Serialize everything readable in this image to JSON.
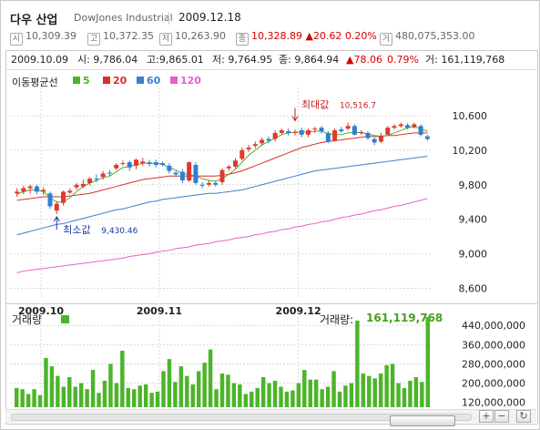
{
  "header": {
    "title": "다우 산업",
    "subtitle": "DowJones Industrial",
    "date": "2009.12.18",
    "quotes": [
      {
        "icon": "시",
        "value": "10,309.39"
      },
      {
        "icon": "고",
        "value": "10,372.35"
      },
      {
        "icon": "저",
        "value": "10,263.90"
      },
      {
        "icon": "종",
        "value": "10,328.89"
      },
      {
        "icon": "",
        "value": "▲20.62"
      },
      {
        "icon": "",
        "value": "0.20%"
      },
      {
        "icon": "거",
        "value": "480,075,353.00"
      }
    ]
  },
  "info_row": {
    "date": "2009.10.09",
    "open": "시: 9,786.04",
    "high": "고:9,865.01",
    "low": "저: 9,764.95",
    "close": "종: 9,864.94",
    "change": "▲78.06",
    "pct": "0.79%",
    "volume": "거: 161,119,768"
  },
  "legend": {
    "title": "이동평균선",
    "items": [
      {
        "label": "5",
        "color": "#4db42a"
      },
      {
        "label": "20",
        "color": "#d9302a"
      },
      {
        "label": "60",
        "color": "#3c7fd0"
      },
      {
        "label": "120",
        "color": "#e85fc8"
      }
    ]
  },
  "annotations": {
    "max_label": "최대값",
    "max_value": "10,516.7",
    "min_label": "최소값",
    "min_value": "9,430.46"
  },
  "volume": {
    "title": "거래량",
    "value_label": "거래량:",
    "value": "161,119,768",
    "ticks": [
      "440,000,000",
      "360,000,000",
      "280,000,000",
      "200,000,000",
      "120,000,000"
    ]
  },
  "chart_data": [
    {
      "type": "candlestick",
      "title": "다우 산업",
      "x_labels": [
        "2009.10",
        "2009.11",
        "2009.12"
      ],
      "y_ticks": [
        10600,
        10200,
        9800,
        9400,
        9000,
        8600
      ],
      "ylim": [
        8500,
        10800
      ],
      "candles": [
        {
          "o": 9700,
          "c": 9720,
          "h": 9760,
          "l": 9660
        },
        {
          "o": 9720,
          "c": 9760,
          "h": 9790,
          "l": 9690
        },
        {
          "o": 9760,
          "c": 9780,
          "h": 9800,
          "l": 9700
        },
        {
          "o": 9780,
          "c": 9720,
          "h": 9800,
          "l": 9690
        },
        {
          "o": 9720,
          "c": 9740,
          "h": 9770,
          "l": 9680
        },
        {
          "o": 9700,
          "c": 9550,
          "h": 9720,
          "l": 9520
        },
        {
          "o": 9500,
          "c": 9580,
          "h": 9610,
          "l": 9460
        },
        {
          "o": 9590,
          "c": 9720,
          "h": 9730,
          "l": 9560
        },
        {
          "o": 9710,
          "c": 9730,
          "h": 9760,
          "l": 9690
        },
        {
          "o": 9770,
          "c": 9800,
          "h": 9820,
          "l": 9740
        },
        {
          "o": 9780,
          "c": 9810,
          "h": 9860,
          "l": 9760
        },
        {
          "o": 9820,
          "c": 9870,
          "h": 9890,
          "l": 9790
        },
        {
          "o": 9870,
          "c": 9860,
          "h": 9920,
          "l": 9830
        },
        {
          "o": 9890,
          "c": 9930,
          "h": 9960,
          "l": 9860
        },
        {
          "o": 9940,
          "c": 9930,
          "h": 9970,
          "l": 9900
        },
        {
          "o": 9990,
          "c": 10030,
          "h": 10050,
          "l": 9970
        },
        {
          "o": 10040,
          "c": 10050,
          "h": 10080,
          "l": 10020
        },
        {
          "o": 10060,
          "c": 10000,
          "h": 10080,
          "l": 9960
        },
        {
          "o": 10020,
          "c": 10090,
          "h": 10100,
          "l": 9980
        },
        {
          "o": 10050,
          "c": 10070,
          "h": 10110,
          "l": 10020
        },
        {
          "o": 10060,
          "c": 10040,
          "h": 10090,
          "l": 10010
        },
        {
          "o": 10060,
          "c": 10030,
          "h": 10090,
          "l": 10000
        },
        {
          "o": 10050,
          "c": 10030,
          "h": 10070,
          "l": 10010
        },
        {
          "o": 10020,
          "c": 9960,
          "h": 10050,
          "l": 9930
        },
        {
          "o": 9940,
          "c": 9920,
          "h": 9960,
          "l": 9890
        },
        {
          "o": 9950,
          "c": 9850,
          "h": 9980,
          "l": 9820
        },
        {
          "o": 9850,
          "c": 10060,
          "h": 10070,
          "l": 9830
        },
        {
          "o": 10030,
          "c": 9820,
          "h": 10060,
          "l": 9800
        },
        {
          "o": 9800,
          "c": 9790,
          "h": 9830,
          "l": 9760
        },
        {
          "o": 9800,
          "c": 9820,
          "h": 9850,
          "l": 9780
        },
        {
          "o": 9820,
          "c": 9800,
          "h": 9840,
          "l": 9780
        },
        {
          "o": 9830,
          "c": 9970,
          "h": 9990,
          "l": 9800
        },
        {
          "o": 9990,
          "c": 10010,
          "h": 10030,
          "l": 9960
        },
        {
          "o": 10010,
          "c": 10080,
          "h": 10110,
          "l": 9990
        },
        {
          "o": 10100,
          "c": 10200,
          "h": 10230,
          "l": 10080
        },
        {
          "o": 10210,
          "c": 10230,
          "h": 10260,
          "l": 10180
        },
        {
          "o": 10250,
          "c": 10270,
          "h": 10300,
          "l": 10220
        },
        {
          "o": 10280,
          "c": 10320,
          "h": 10350,
          "l": 10260
        },
        {
          "o": 10330,
          "c": 10310,
          "h": 10360,
          "l": 10280
        },
        {
          "o": 10330,
          "c": 10400,
          "h": 10430,
          "l": 10300
        },
        {
          "o": 10400,
          "c": 10430,
          "h": 10450,
          "l": 10380
        },
        {
          "o": 10420,
          "c": 10400,
          "h": 10450,
          "l": 10370
        },
        {
          "o": 10400,
          "c": 10410,
          "h": 10440,
          "l": 10370
        },
        {
          "o": 10430,
          "c": 10380,
          "h": 10460,
          "l": 10350
        },
        {
          "o": 10380,
          "c": 10430,
          "h": 10450,
          "l": 10350
        },
        {
          "o": 10440,
          "c": 10450,
          "h": 10470,
          "l": 10400
        },
        {
          "o": 10460,
          "c": 10420,
          "h": 10480,
          "l": 10390
        },
        {
          "o": 10400,
          "c": 10300,
          "h": 10420,
          "l": 10280
        },
        {
          "o": 10310,
          "c": 10430,
          "h": 10450,
          "l": 10300
        },
        {
          "o": 10440,
          "c": 10420,
          "h": 10470,
          "l": 10400
        },
        {
          "o": 10450,
          "c": 10480,
          "h": 10520,
          "l": 10430
        },
        {
          "o": 10480,
          "c": 10380,
          "h": 10500,
          "l": 10370
        },
        {
          "o": 10400,
          "c": 10410,
          "h": 10430,
          "l": 10380
        },
        {
          "o": 10400,
          "c": 10340,
          "h": 10420,
          "l": 10320
        },
        {
          "o": 10330,
          "c": 10290,
          "h": 10350,
          "l": 10260
        },
        {
          "o": 10300,
          "c": 10370,
          "h": 10400,
          "l": 10280
        },
        {
          "o": 10380,
          "c": 10460,
          "h": 10480,
          "l": 10370
        },
        {
          "o": 10460,
          "c": 10480,
          "h": 10500,
          "l": 10440
        },
        {
          "o": 10480,
          "c": 10500,
          "h": 10520,
          "l": 10460
        },
        {
          "o": 10490,
          "c": 10460,
          "h": 10510,
          "l": 10440
        },
        {
          "o": 10470,
          "c": 10500,
          "h": 10520,
          "l": 10450
        },
        {
          "o": 10480,
          "c": 10380,
          "h": 10500,
          "l": 10360
        },
        {
          "o": 10360,
          "c": 10330,
          "h": 10380,
          "l": 10310
        }
      ],
      "ma5": [
        9690,
        9720,
        9740,
        9740,
        9720,
        9650,
        9600,
        9600,
        9650,
        9720,
        9780,
        9820,
        9850,
        9880,
        9900,
        9950,
        10000,
        10010,
        10030,
        10050,
        10050,
        10050,
        10040,
        10000,
        9970,
        9930,
        9920,
        9900,
        9870,
        9850,
        9840,
        9870,
        9920,
        9980,
        10060,
        10140,
        10200,
        10260,
        10300,
        10340,
        10380,
        10400,
        10410,
        10410,
        10410,
        10420,
        10420,
        10390,
        10380,
        10380,
        10400,
        10410,
        10400,
        10390,
        10370,
        10360,
        10370,
        10400,
        10430,
        10460,
        10470,
        10450,
        10420
      ],
      "ma20": [
        9620,
        9630,
        9640,
        9650,
        9660,
        9660,
        9660,
        9660,
        9670,
        9680,
        9690,
        9700,
        9720,
        9740,
        9760,
        9780,
        9800,
        9820,
        9840,
        9860,
        9870,
        9880,
        9890,
        9900,
        9900,
        9900,
        9900,
        9900,
        9900,
        9900,
        9900,
        9910,
        9920,
        9940,
        9960,
        9990,
        10020,
        10050,
        10080,
        10110,
        10140,
        10170,
        10200,
        10230,
        10250,
        10270,
        10290,
        10300,
        10310,
        10320,
        10330,
        10340,
        10350,
        10360,
        10360,
        10360,
        10370,
        10370,
        10380,
        10390,
        10400,
        10400,
        10400
      ],
      "ma60": [
        9220,
        9240,
        9260,
        9280,
        9300,
        9320,
        9340,
        9350,
        9370,
        9390,
        9410,
        9430,
        9450,
        9470,
        9490,
        9510,
        9520,
        9540,
        9560,
        9580,
        9600,
        9610,
        9630,
        9640,
        9650,
        9660,
        9670,
        9680,
        9690,
        9700,
        9700,
        9710,
        9720,
        9730,
        9740,
        9760,
        9780,
        9800,
        9820,
        9840,
        9860,
        9880,
        9900,
        9920,
        9940,
        9960,
        9970,
        9980,
        9990,
        10000,
        10010,
        10020,
        10030,
        10040,
        10050,
        10060,
        10070,
        10080,
        10090,
        10100,
        10110,
        10120,
        10130
      ],
      "ma120": [
        8780,
        8800,
        8810,
        8820,
        8830,
        8840,
        8850,
        8860,
        8870,
        8880,
        8890,
        8900,
        8910,
        8920,
        8930,
        8940,
        8950,
        8970,
        8980,
        8990,
        9000,
        9020,
        9030,
        9040,
        9060,
        9070,
        9080,
        9100,
        9110,
        9120,
        9140,
        9150,
        9160,
        9180,
        9190,
        9200,
        9220,
        9230,
        9250,
        9260,
        9280,
        9290,
        9310,
        9320,
        9340,
        9350,
        9370,
        9380,
        9400,
        9420,
        9430,
        9450,
        9460,
        9480,
        9500,
        9510,
        9530,
        9550,
        9560,
        9580,
        9600,
        9620,
        9640
      ]
    },
    {
      "type": "bar",
      "title": "거래량",
      "y_ticks": [
        440000000,
        360000000,
        280000000,
        200000000,
        120000000
      ],
      "ylim": [
        100000000,
        490000000
      ],
      "values": [
        180,
        175,
        155,
        175,
        150,
        305,
        270,
        230,
        185,
        225,
        185,
        200,
        175,
        255,
        160,
        210,
        280,
        200,
        335,
        180,
        175,
        190,
        195,
        160,
        165,
        250,
        300,
        205,
        270,
        230,
        195,
        250,
        285,
        340,
        175,
        240,
        235,
        200,
        195,
        155,
        165,
        180,
        225,
        200,
        210,
        185,
        165,
        170,
        200,
        255,
        215,
        215,
        175,
        185,
        250,
        165,
        190,
        200,
        460,
        240,
        230,
        220,
        240,
        275,
        280,
        200,
        180,
        210,
        225,
        205,
        475
      ]
    }
  ]
}
